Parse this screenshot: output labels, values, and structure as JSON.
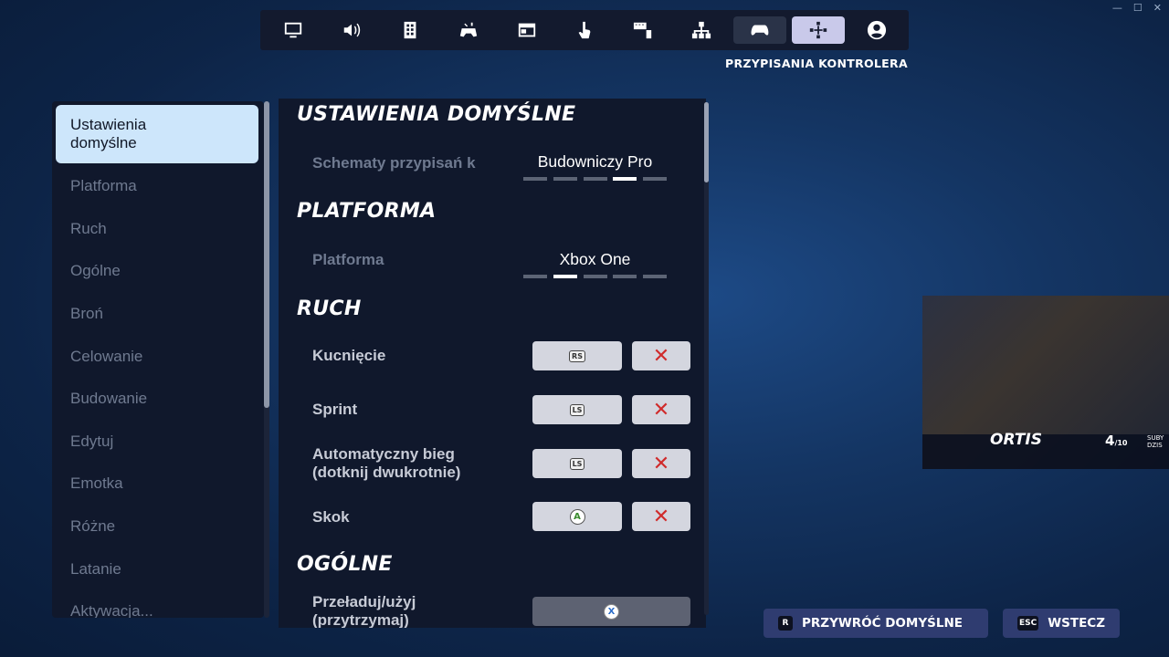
{
  "window_controls": [
    "—",
    "☐",
    "✕"
  ],
  "tabs": [
    {
      "icon": "monitor-icon",
      "state": "normal"
    },
    {
      "icon": "speaker-icon",
      "state": "normal"
    },
    {
      "icon": "gamepad-layout-icon",
      "state": "normal"
    },
    {
      "icon": "accessibility-controller-icon",
      "state": "normal"
    },
    {
      "icon": "window-icon",
      "state": "normal"
    },
    {
      "icon": "touch-icon",
      "state": "normal"
    },
    {
      "icon": "keyboard-mouse-icon",
      "state": "normal"
    },
    {
      "icon": "network-icon",
      "state": "normal"
    },
    {
      "icon": "controller-icon",
      "state": "hover"
    },
    {
      "icon": "controller-bindings-icon",
      "state": "active"
    },
    {
      "icon": "account-icon",
      "state": "normal"
    }
  ],
  "section_caption": "PRZYPISANIA KONTROLERA",
  "sidebar": {
    "items": [
      {
        "label_line1": "Ustawienia",
        "label_line2": "domyślne",
        "active": true
      },
      {
        "label": "Platforma"
      },
      {
        "label": "Ruch"
      },
      {
        "label": "Ogólne"
      },
      {
        "label": "Broń"
      },
      {
        "label": "Celowanie"
      },
      {
        "label": "Budowanie"
      },
      {
        "label": "Edytuj"
      },
      {
        "label": "Emotka"
      },
      {
        "label": "Różne"
      },
      {
        "label": "Latanie"
      },
      {
        "label": "Aktywacja..."
      }
    ]
  },
  "main": {
    "defaults": {
      "heading": "USTAWIENIA DOMYŚLNE",
      "scheme_label": "Schematy przypisań k",
      "scheme_value": "Budowniczy Pro",
      "scheme_pips": 5,
      "scheme_pip_selected": 4
    },
    "platform": {
      "heading": "PLATFORMA",
      "label": "Platforma",
      "value": "Xbox One",
      "pips": 5,
      "pip_selected": 2
    },
    "movement": {
      "heading": "RUCH",
      "rows": [
        {
          "label": "Kucnięcie",
          "binding": "RS"
        },
        {
          "label": "Sprint",
          "binding": "LS"
        },
        {
          "label_line1": "Automatyczny bieg",
          "label_line2": "(dotknij dwukrotnie)",
          "binding": "LS"
        },
        {
          "label": "Skok",
          "binding": "A"
        }
      ]
    },
    "general": {
      "heading": "OGÓLNE",
      "rows": [
        {
          "label_line1": "Przeładuj/użyj",
          "label_line2": "(przytrzymaj)",
          "binding": "X"
        }
      ]
    },
    "clear_symbol": "✕"
  },
  "footer": {
    "reset": {
      "key": "R",
      "label": "PRZYWRÓĆ DOMYŚLNE"
    },
    "back": {
      "key": "ESC",
      "label": "WSTECZ"
    }
  },
  "webcam": {
    "name": "ORTIS",
    "count": "4",
    "count_suffix": "/10",
    "subs_line1": "SUBY",
    "subs_line2": "DZIS"
  },
  "colors": {
    "active_tab": "#c9c9ea",
    "active_nav": "#cde6fb",
    "clear_red": "#d02b2b",
    "footer_button": "#2f3c70"
  }
}
